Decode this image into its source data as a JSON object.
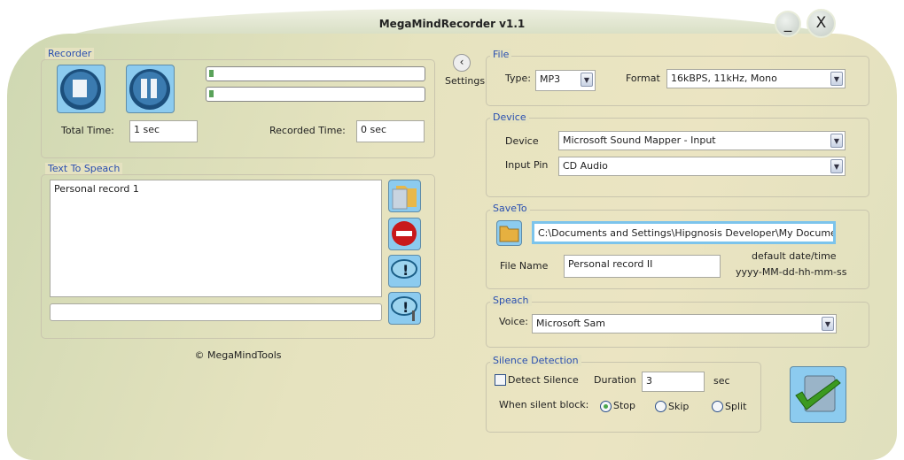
{
  "window": {
    "title": "MegaMindRecorder v1.1",
    "minimize": "_",
    "close": "X"
  },
  "recorder": {
    "legend": "Recorder",
    "total_time_label": "Total Time:",
    "total_time": "1 sec",
    "recorded_time_label": "Recorded Time:",
    "recorded_time": "0 sec",
    "level1": 0.01,
    "level2": 0.01
  },
  "tts": {
    "legend": "Text To Speach",
    "text": "Personal record 1",
    "input": ""
  },
  "copyright": "© MegaMindTools",
  "settings": {
    "label": "Settings"
  },
  "file": {
    "legend": "File",
    "type_label": "Type:",
    "type": "MP3",
    "format_label": "Format",
    "format": "16kBPS, 11kHz, Mono"
  },
  "device": {
    "legend": "Device",
    "device_label": "Device",
    "device": "Microsoft Sound Mapper - Input",
    "pin_label": "Input Pin",
    "pin": "CD Audio"
  },
  "saveto": {
    "legend": "SaveTo",
    "path": "C:\\Documents and Settings\\Hipgnosis Developer\\My Documents\\Me",
    "filename_label": "File Name",
    "filename": "Personal record II",
    "hint1": "default date/time",
    "hint2": "yyyy-MM-dd-hh-mm-ss"
  },
  "speach": {
    "legend": "Speach",
    "voice_label": "Voice:",
    "voice": "Microsoft Sam"
  },
  "silence": {
    "legend": "Silence Detection",
    "detect_label": "Detect Silence",
    "detect_checked": false,
    "duration_label": "Duration",
    "duration": "3",
    "unit": "sec",
    "block_label": "When silent block:",
    "options": [
      "Stop",
      "Skip",
      "Split"
    ],
    "selected": "Stop"
  }
}
